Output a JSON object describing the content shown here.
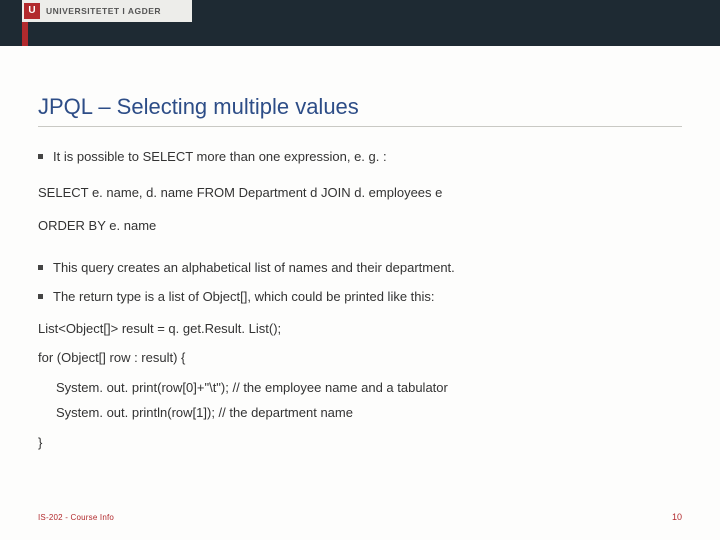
{
  "logo": {
    "mark_letter": "U",
    "text": "UNIVERSITETET I AGDER"
  },
  "title": "JPQL – Selecting multiple values",
  "bullets": {
    "b1": "It is possible to SELECT more than one expression, e. g. :",
    "b2": "This query creates an alphabetical list of names and their department.",
    "b3": "The return type is a list of Object[], which could be printed like this:"
  },
  "sql": {
    "line1": "SELECT e. name, d. name FROM Department d JOIN d. employees e",
    "line2": "ORDER BY e. name"
  },
  "code": {
    "l1": "List<Object[]> result = q. get.Result. List();",
    "l2": "for (Object[] row : result) {",
    "l3": "System. out. print(row[0]+\"\\t\"); // the employee name and a tabulator",
    "l4": "System. out. println(row[1]); // the department name",
    "l5": "}"
  },
  "footer": {
    "left": "IS-202 - Course Info",
    "right": "10"
  }
}
